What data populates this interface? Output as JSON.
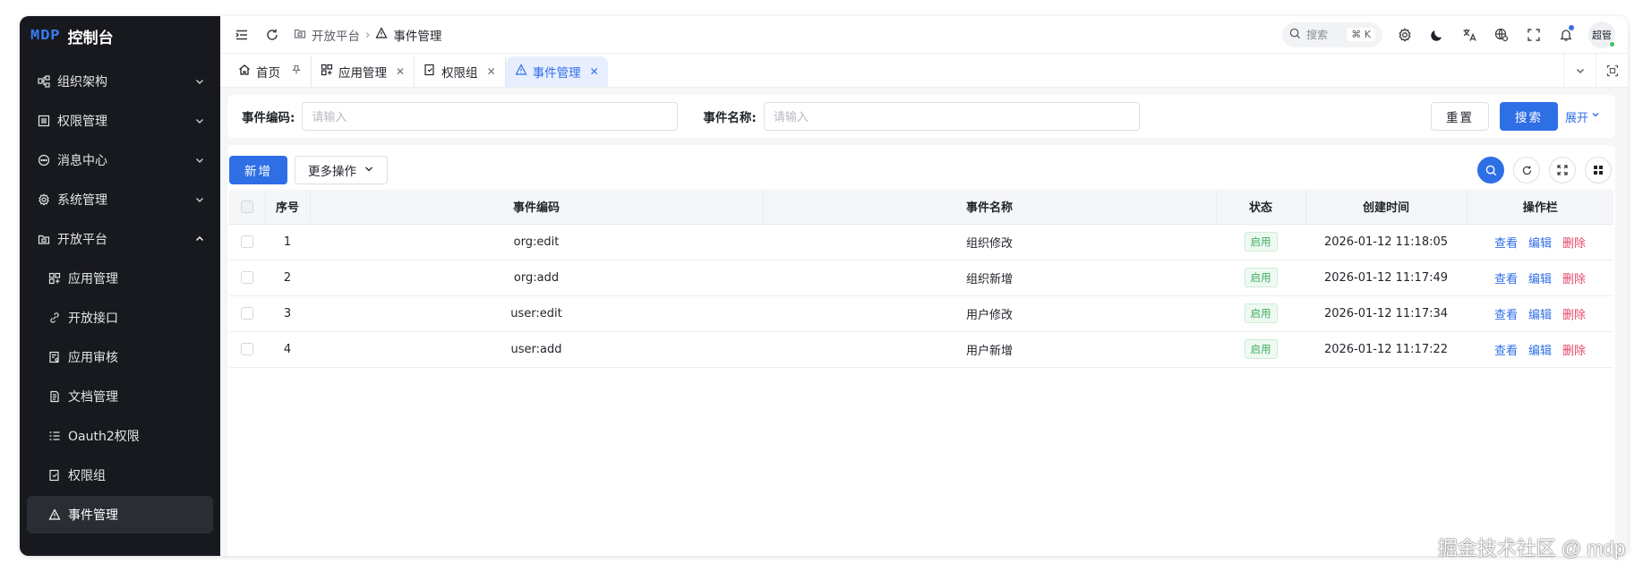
{
  "app": {
    "logo_mark": "MDP",
    "title": "控制台"
  },
  "sidebar": {
    "items": [
      {
        "label": "组织架构",
        "icon": "org-icon"
      },
      {
        "label": "权限管理",
        "icon": "permission-icon"
      },
      {
        "label": "消息中心",
        "icon": "message-icon"
      },
      {
        "label": "系统管理",
        "icon": "gear-icon"
      },
      {
        "label": "开放平台",
        "icon": "open-platform-icon",
        "expanded": true
      }
    ],
    "sub_items": [
      {
        "label": "应用管理",
        "icon": "app-icon"
      },
      {
        "label": "开放接口",
        "icon": "link-icon"
      },
      {
        "label": "应用审核",
        "icon": "audit-icon"
      },
      {
        "label": "文档管理",
        "icon": "doc-icon"
      },
      {
        "label": "Oauth2权限",
        "icon": "list-icon"
      },
      {
        "label": "权限组",
        "icon": "perm-group-icon"
      },
      {
        "label": "事件管理",
        "icon": "event-icon",
        "active": true
      }
    ]
  },
  "header": {
    "breadcrumb": [
      "开放平台",
      "事件管理"
    ],
    "search": {
      "label": "搜索",
      "shortcut": "⌘ K"
    },
    "avatar": "超管"
  },
  "tabs": [
    {
      "label": "首页",
      "pinned": true
    },
    {
      "label": "应用管理"
    },
    {
      "label": "权限组"
    },
    {
      "label": "事件管理",
      "active": true
    }
  ],
  "filter": {
    "code_label": "事件编码:",
    "code_placeholder": "请输入",
    "name_label": "事件名称:",
    "name_placeholder": "请输入",
    "reset": "重置",
    "search": "搜索",
    "expand": "展开"
  },
  "toolbar": {
    "add": "新增",
    "more": "更多操作"
  },
  "table": {
    "columns": [
      "序号",
      "事件编码",
      "事件名称",
      "状态",
      "创建时间",
      "操作栏"
    ],
    "rows": [
      {
        "no": "1",
        "code": "org:edit",
        "name": "组织修改",
        "status": "启用",
        "created": "2026-01-12 11:18:05"
      },
      {
        "no": "2",
        "code": "org:add",
        "name": "组织新增",
        "status": "启用",
        "created": "2026-01-12 11:17:49"
      },
      {
        "no": "3",
        "code": "user:edit",
        "name": "用户修改",
        "status": "启用",
        "created": "2026-01-12 11:17:34"
      },
      {
        "no": "4",
        "code": "user:add",
        "name": "用户新增",
        "status": "启用",
        "created": "2026-01-12 11:17:22"
      }
    ],
    "actions": {
      "view": "查看",
      "edit": "编辑",
      "delete": "删除"
    }
  },
  "watermark": "掘金技术社区 @ mdp",
  "colors": {
    "primary": "#2f6fe6",
    "sidebar_bg": "#17191e",
    "success": "#3fae62",
    "danger": "#e6466b"
  }
}
